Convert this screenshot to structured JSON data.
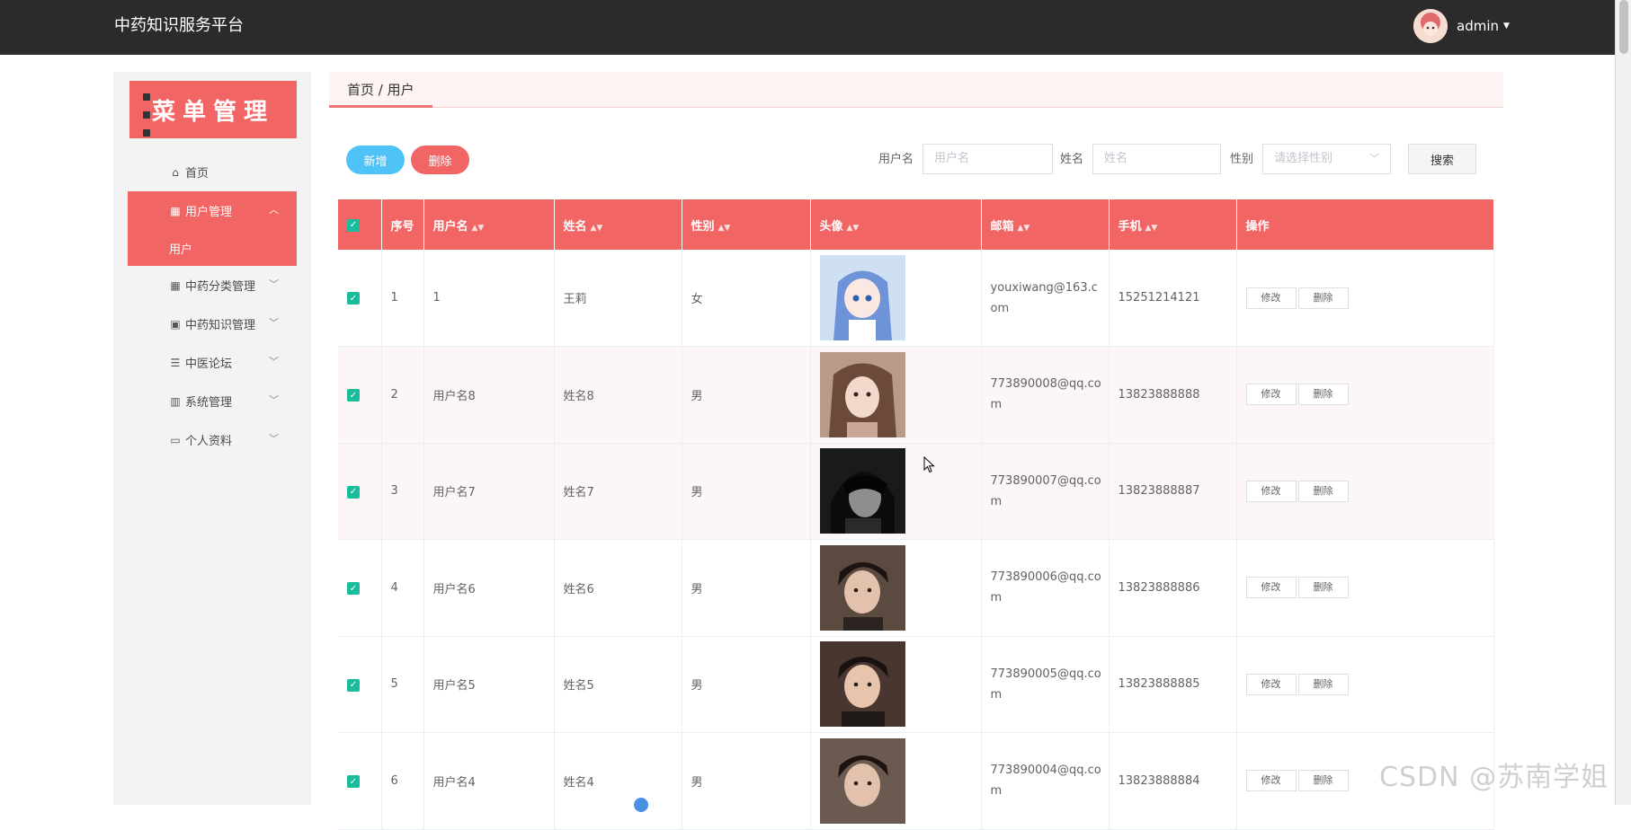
{
  "header": {
    "brand": "中药知识服务平台",
    "username": "admin"
  },
  "sidebar": {
    "title": "菜单管理",
    "items": [
      {
        "label": "首页",
        "icon": "home-icon"
      },
      {
        "label": "用户管理",
        "icon": "grid-icon",
        "open": true
      },
      {
        "label": "中药分类管理",
        "icon": "grid-icon"
      },
      {
        "label": "中药知识管理",
        "icon": "image-icon"
      },
      {
        "label": "中医论坛",
        "icon": "list-icon"
      },
      {
        "label": "系统管理",
        "icon": "chart-icon"
      },
      {
        "label": "个人资料",
        "icon": "card-icon"
      }
    ],
    "sub_item": "用户"
  },
  "breadcrumb": "首页 / 用户",
  "toolbar": {
    "add_label": "新增",
    "delete_label": "删除"
  },
  "filters": {
    "username_label": "用户名",
    "username_placeholder": "用户名",
    "name_label": "姓名",
    "name_placeholder": "姓名",
    "gender_label": "性别",
    "gender_placeholder": "请选择性别",
    "search_label": "搜索"
  },
  "table": {
    "headers": [
      "序号",
      "用户名",
      "姓名",
      "性别",
      "头像",
      "邮箱",
      "手机",
      "操作"
    ],
    "rows": [
      {
        "no": "1",
        "username": "1",
        "name": "王莉",
        "gender": "女",
        "email": "youxiwang@163.com",
        "phone": "15251214121"
      },
      {
        "no": "2",
        "username": "用户名8",
        "name": "姓名8",
        "gender": "男",
        "email": "773890008@qq.com",
        "phone": "13823888888"
      },
      {
        "no": "3",
        "username": "用户名7",
        "name": "姓名7",
        "gender": "男",
        "email": "773890007@qq.com",
        "phone": "13823888887"
      },
      {
        "no": "4",
        "username": "用户名6",
        "name": "姓名6",
        "gender": "男",
        "email": "773890006@qq.com",
        "phone": "13823888886"
      },
      {
        "no": "5",
        "username": "用户名5",
        "name": "姓名5",
        "gender": "男",
        "email": "773890005@qq.com",
        "phone": "13823888885"
      },
      {
        "no": "6",
        "username": "用户名4",
        "name": "姓名4",
        "gender": "男",
        "email": "773890004@qq.com",
        "phone": "13823888884"
      }
    ],
    "edit_label": "修改",
    "delete_label": "删除"
  },
  "watermark": "CSDN @苏南学姐",
  "colors": {
    "accent": "#f26565",
    "topbar": "#2b2b2b",
    "add": "#4fc3f7",
    "check": "#1abc9c"
  }
}
